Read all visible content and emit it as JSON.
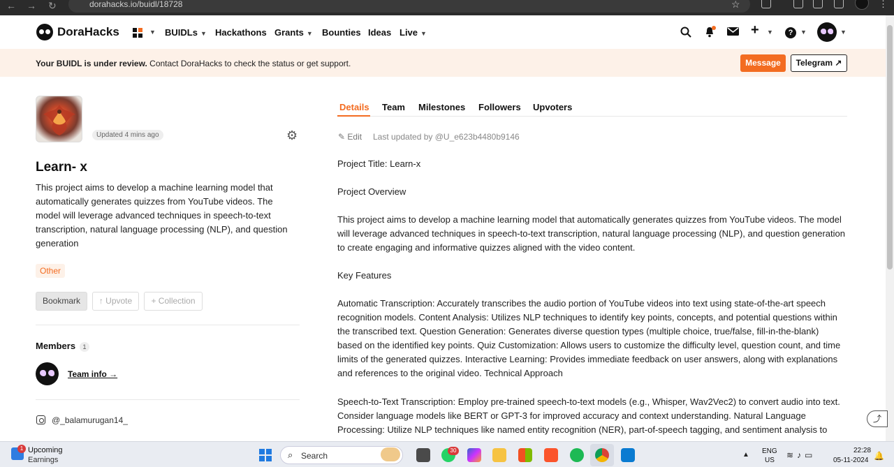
{
  "browser": {
    "url": "dorahacks.io/buidl/18728"
  },
  "header": {
    "brand": "DoraHacks",
    "nav": [
      {
        "label": "BUIDLs",
        "has_caret": true
      },
      {
        "label": "Hackathons",
        "has_caret": false
      },
      {
        "label": "Grants",
        "has_caret": true
      },
      {
        "label": "Bounties",
        "has_caret": false
      },
      {
        "label": "Ideas",
        "has_caret": false
      },
      {
        "label": "Live",
        "has_caret": true
      }
    ]
  },
  "notice": {
    "bold": "Your BUIDL is under review.",
    "text": " Contact DoraHacks to check the status or get support.",
    "message_label": "Message",
    "telegram_label": "Telegram ↗"
  },
  "project": {
    "updated": "Updated 4 mins ago",
    "title": "Learn- x",
    "description": "This project aims to develop a machine learning model that automatically generates quizzes from YouTube videos. The model will leverage advanced techniques in speech-to-text transcription, natural language processing (NLP), and question generation",
    "tag": "Other",
    "bookmark_label": "Bookmark",
    "upvote_label": "↑ Upvote",
    "collection_label": "+ Collection",
    "members_label": "Members",
    "members_count": "1",
    "team_info_label": "Team info →",
    "instagram_handle": "@_balamurugan14_"
  },
  "details": {
    "tabs": [
      "Details",
      "Team",
      "Milestones",
      "Followers",
      "Upvoters"
    ],
    "edit_label": "Edit",
    "last_updated": "Last updated by @U_e623b4480b9146",
    "paragraphs": [
      "Project Title: Learn-x",
      "Project Overview",
      "This project aims to develop a machine learning model that automatically generates quizzes from YouTube videos. The model will leverage advanced techniques in speech-to-text transcription, natural language processing (NLP), and question generation to create engaging and informative quizzes aligned with the video content.",
      "Key Features",
      "Automatic Transcription: Accurately transcribes the audio portion of YouTube videos into text using state-of-the-art speech recognition models. Content Analysis: Utilizes NLP techniques to identify key points, concepts, and potential questions within the transcribed text. Question Generation: Generates diverse question types (multiple choice, true/false, fill-in-the-blank) based on the identified key points. Quiz Customization: Allows users to customize the difficulty level, question count, and time limits of the generated quizzes. Interactive Learning: Provides immediate feedback on user answers, along with explanations and references to the original video. Technical Approach",
      "Speech-to-Text Transcription: Employ pre-trained speech-to-text models (e.g., Whisper, Wav2Vec2) to convert audio into text. Consider language models like BERT or GPT-3 for improved accuracy and context understanding. Natural Language Processing: Utilize NLP techniques like named entity recognition (NER), part-of-speech tagging, and sentiment analysis to"
    ]
  },
  "taskbar": {
    "widget_badge": "1",
    "widget_line1": "Upcoming",
    "widget_line2": "Earnings",
    "search_placeholder": "Search",
    "whatsapp_badge": "30",
    "lang1": "ENG",
    "lang2": "US",
    "time": "22:28",
    "date": "05-11-2024"
  },
  "colors": {
    "accent": "#f36c21",
    "notice_bg": "#fdf1e8"
  }
}
